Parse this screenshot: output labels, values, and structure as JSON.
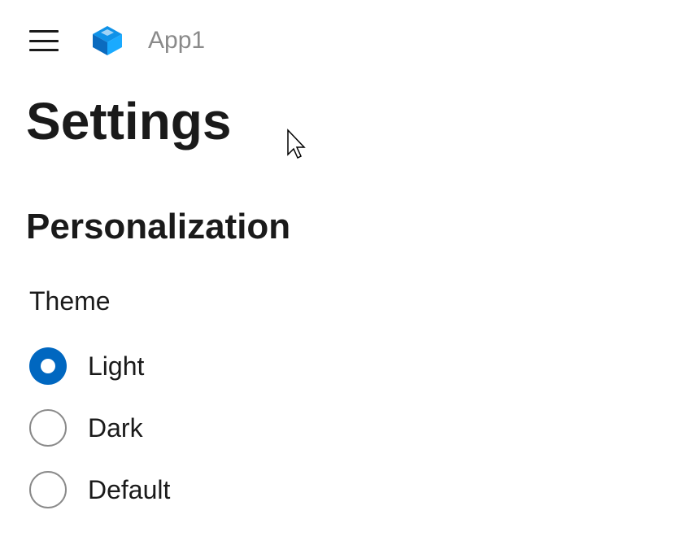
{
  "header": {
    "app_title": "App1"
  },
  "page": {
    "title": "Settings"
  },
  "personalization": {
    "section_title": "Personalization",
    "theme": {
      "label": "Theme",
      "options": [
        {
          "label": "Light",
          "selected": true
        },
        {
          "label": "Dark",
          "selected": false
        },
        {
          "label": "Default",
          "selected": false
        }
      ]
    }
  },
  "colors": {
    "accent": "#0067c0"
  }
}
